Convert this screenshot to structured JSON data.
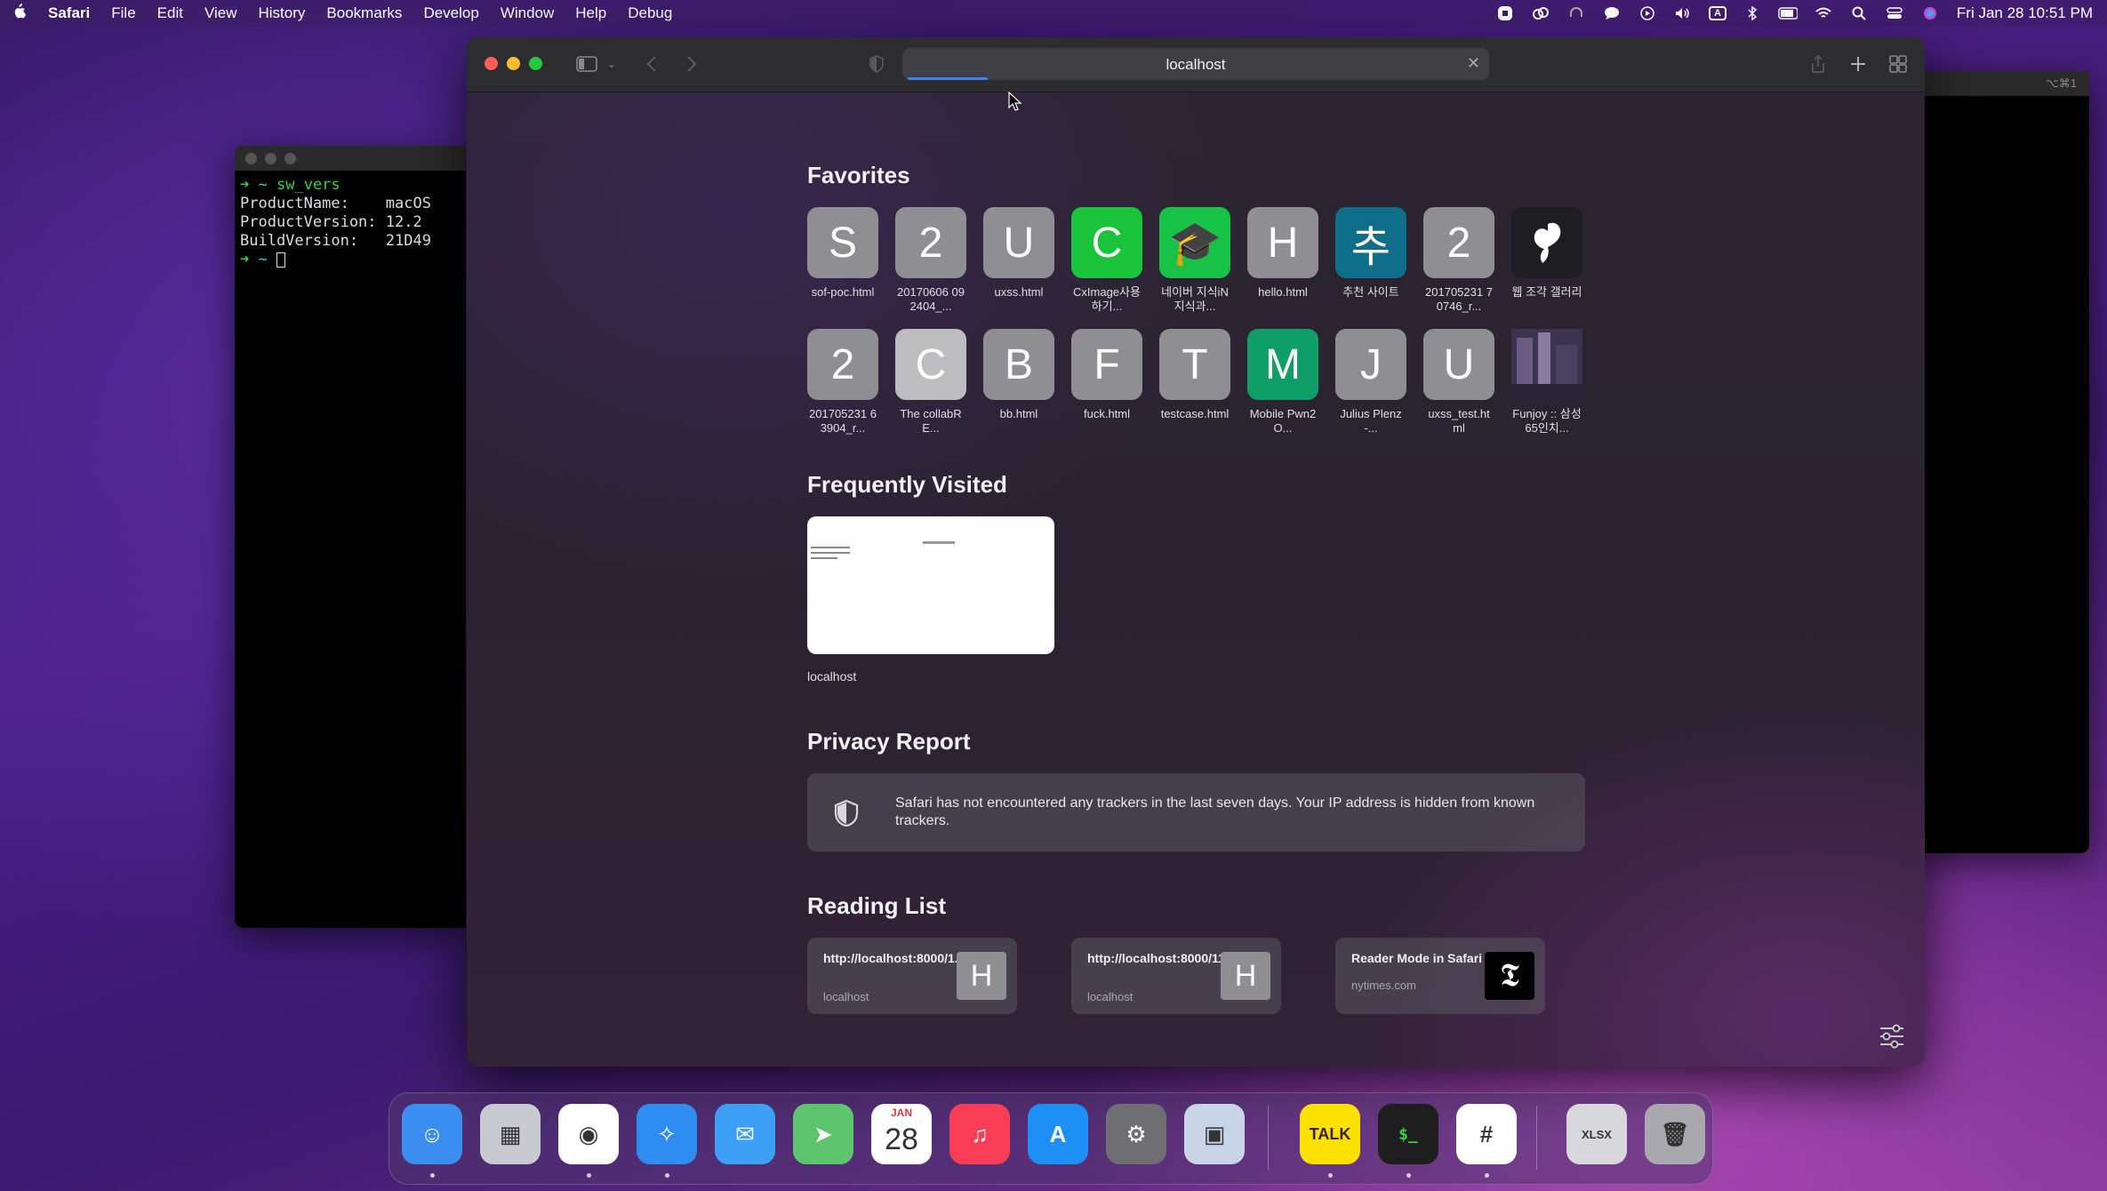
{
  "menubar": {
    "app_name": "Safari",
    "items": [
      "File",
      "Edit",
      "View",
      "History",
      "Bookmarks",
      "Develop",
      "Window",
      "Help",
      "Debug"
    ],
    "status_icons": [
      "record-icon",
      "creative-cloud-icon",
      "headphones-icon",
      "messages-icon",
      "play-icon",
      "volume-icon",
      "input-source-icon",
      "bluetooth-icon",
      "battery-icon",
      "wifi-icon",
      "spotlight-icon",
      "control-center-icon",
      "siri-icon"
    ],
    "input_source": "A",
    "clock": "Fri Jan 28  10:51 PM"
  },
  "terminal": {
    "lines": [
      {
        "prompt": "➜",
        "dir": "~",
        "cmd": "sw_vers"
      },
      {
        "text": "ProductName:    macOS"
      },
      {
        "text": "ProductVersion: 12.2"
      },
      {
        "text": "BuildVersion:   21D49"
      },
      {
        "prompt": "➜",
        "dir": "~",
        "cmd": ""
      }
    ]
  },
  "terminal2": {
    "shortcut": "⌥⌘1"
  },
  "safari": {
    "address": "localhost",
    "favorites_title": "Favorites",
    "favorites": [
      {
        "letter": "S",
        "label": "sof-poc.html",
        "color": "#8e8e93"
      },
      {
        "letter": "2",
        "label": "20170606 092404_...",
        "color": "#8e8e93"
      },
      {
        "letter": "U",
        "label": "uxss.html",
        "color": "#8e8e93"
      },
      {
        "letter": "C",
        "label": "CxImage사용하기...",
        "color": "#19c43a"
      },
      {
        "letter": "🎓",
        "label": "네이버 지식iN  지식과...",
        "color": "#17c247"
      },
      {
        "letter": "H",
        "label": "hello.html",
        "color": "#8e8e93"
      },
      {
        "letter": "추",
        "label": "추천 사이트",
        "color": "#0f6e8a"
      },
      {
        "letter": "2",
        "label": "201705231 70746_r...",
        "color": "#8e8e93"
      },
      {
        "letter": "",
        "label": "웹 조각 갤러리",
        "color": "#1e1e22"
      },
      {
        "letter": "2",
        "label": "201705231 63904_r...",
        "color": "#8e8e93"
      },
      {
        "letter": "C",
        "label": "The collabRE...",
        "color": "#bdbdc0"
      },
      {
        "letter": "B",
        "label": "bb.html",
        "color": "#8e8e93"
      },
      {
        "letter": "F",
        "label": "fuck.html",
        "color": "#8e8e93"
      },
      {
        "letter": "T",
        "label": "testcase.html",
        "color": "#8e8e93"
      },
      {
        "letter": "M",
        "label": "Mobile Pwn2O...",
        "color": "#0f9d68"
      },
      {
        "letter": "J",
        "label": "Julius Plenz -...",
        "color": "#8e8e93"
      },
      {
        "letter": "U",
        "label": "uxss_test.html",
        "color": "#8e8e93"
      },
      {
        "letter": "",
        "label": "Funjoy :: 삼성 65인치...",
        "color": "#5a4a6e"
      }
    ],
    "frequently_visited_title": "Frequently Visited",
    "frequently_visited": [
      {
        "label": "localhost"
      }
    ],
    "privacy_title": "Privacy Report",
    "privacy_text": "Safari has not encountered any trackers in the last seven days. Your IP address is hidden from known trackers.",
    "reading_list_title": "Reading List",
    "reading_list": [
      {
        "title": "http://localhost:8000/1.html",
        "subtitle": "localhost",
        "thumb": "H"
      },
      {
        "title": "http://localhost:8000/11.html",
        "subtitle": "localhost",
        "thumb": "H"
      },
      {
        "title": "Reader Mode in Safari",
        "subtitle": "nytimes.com",
        "thumb": "𝕿"
      }
    ]
  },
  "dock": {
    "apps": [
      {
        "name": "Finder",
        "glyph": "☺",
        "color": "#3b8df0",
        "running": true
      },
      {
        "name": "Launchpad",
        "glyph": "▦",
        "color": "#c9c9d2",
        "running": false
      },
      {
        "name": "Chrome",
        "glyph": "◉",
        "color": "#ffffff",
        "running": true
      },
      {
        "name": "Safari",
        "glyph": "✧",
        "color": "#2f8cf0",
        "running": true
      },
      {
        "name": "Mail",
        "glyph": "✉",
        "color": "#3ea0f5",
        "running": false
      },
      {
        "name": "Maps",
        "glyph": "➤",
        "color": "#5ec46e",
        "running": false
      },
      {
        "name": "Calendar",
        "glyph": "28",
        "month": "JAN",
        "color": "#ffffff",
        "running": false
      },
      {
        "name": "Music",
        "glyph": "♫",
        "color": "#fa3d56",
        "running": false
      },
      {
        "name": "App Store",
        "glyph": "A",
        "color": "#1e8ff5",
        "running": false
      },
      {
        "name": "System Preferences",
        "glyph": "⚙",
        "color": "#6e6e73",
        "running": false
      },
      {
        "name": "VirtualBox",
        "glyph": "▣",
        "color": "#c9d4e6",
        "running": false
      },
      {
        "name": "KakaoTalk",
        "glyph": "TALK",
        "color": "#fae100",
        "running": true
      },
      {
        "name": "Terminal",
        "glyph": "$_",
        "color": "#1e1e1e",
        "running": true
      },
      {
        "name": "Slack",
        "glyph": "#",
        "color": "#ffffff",
        "running": true
      },
      {
        "name": "Documents",
        "glyph": "XLSX",
        "color": "#d8d8dc",
        "running": false
      },
      {
        "name": "Trash",
        "glyph": "🗑",
        "color": "#a8a8ae",
        "running": false
      }
    ]
  }
}
